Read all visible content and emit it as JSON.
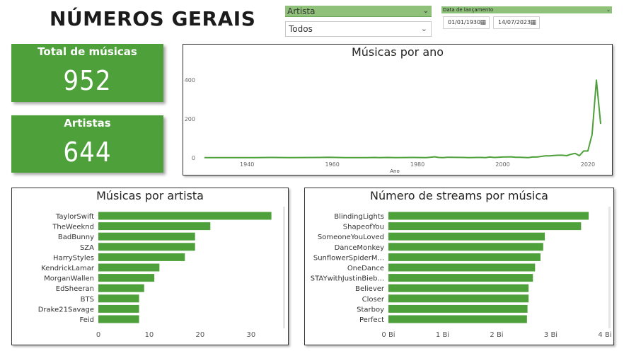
{
  "header": {
    "title": "NÚMEROS GERAIS"
  },
  "filters": {
    "artist_slicer_label": "Artista",
    "artist_dropdown_value": "Todos",
    "date_slicer_label": "Data de lançamento",
    "date_start": "01/01/1930",
    "date_end": "14/07/2023"
  },
  "cards": {
    "total_label": "Total de músicas",
    "total_value": "952",
    "artists_label": "Artistas",
    "artists_value": "644"
  },
  "colors": {
    "accent": "#4ea03a",
    "slicer": "#8fc17a"
  },
  "chart_data": [
    {
      "type": "line",
      "title": "Músicas por ano",
      "xlabel": "Ano",
      "ylabel": "",
      "xlim": [
        1930,
        2024
      ],
      "ylim": [
        0,
        430
      ],
      "x_ticks": [
        "1940",
        "1960",
        "1980",
        "2000",
        "2020"
      ],
      "x_tick_values": [
        1940,
        1960,
        1980,
        2000,
        2020
      ],
      "y_ticks": [
        "0",
        "200",
        "400"
      ],
      "y_tick_values": [
        0,
        200,
        400
      ],
      "x": [
        1930,
        1942,
        1946,
        1950,
        1957,
        1959,
        1963,
        1968,
        1970,
        1971,
        1973,
        1975,
        1979,
        1982,
        1983,
        1984,
        1985,
        1986,
        1987,
        1991,
        1992,
        1994,
        1995,
        1996,
        1997,
        1998,
        1999,
        2000,
        2002,
        2003,
        2004,
        2005,
        2006,
        2007,
        2008,
        2010,
        2011,
        2012,
        2013,
        2014,
        2015,
        2016,
        2017,
        2018,
        2019,
        2020,
        2021,
        2022,
        2023
      ],
      "y": [
        1,
        1,
        2,
        1,
        2,
        3,
        1,
        1,
        2,
        1,
        2,
        1,
        2,
        1,
        3,
        5,
        2,
        1,
        3,
        2,
        1,
        2,
        2,
        1,
        4,
        2,
        3,
        4,
        5,
        3,
        3,
        2,
        1,
        4,
        4,
        10,
        10,
        12,
        13,
        13,
        11,
        18,
        23,
        11,
        35,
        35,
        120,
        400,
        175
      ]
    },
    {
      "type": "bar",
      "orientation": "horizontal",
      "title": "Músicas por artista",
      "categories": [
        "TaylorSwift",
        "TheWeeknd",
        "BadBunny",
        "SZA",
        "HarryStyles",
        "KendrickLamar",
        "MorganWallen",
        "EdSheeran",
        "BTS",
        "Drake21Savage",
        "Feid"
      ],
      "values": [
        34,
        22,
        19,
        19,
        17,
        12,
        11,
        9,
        8,
        8,
        8
      ],
      "x_ticks": [
        "0",
        "10",
        "20",
        "30"
      ],
      "x_tick_values": [
        0,
        10,
        20,
        30
      ],
      "xlim": [
        0,
        36
      ]
    },
    {
      "type": "bar",
      "orientation": "horizontal",
      "title": "Número de streams por música",
      "categories": [
        "BlindingLights",
        "ShapeofYou",
        "SomeoneYouLoved",
        "DanceMonkey",
        "SunflowerSpiderM...",
        "OneDance",
        "STAYwithJustinBieb...",
        "Believer",
        "Closer",
        "Starboy",
        "Perfect"
      ],
      "values": [
        3.7,
        3.56,
        2.89,
        2.86,
        2.81,
        2.71,
        2.67,
        2.59,
        2.59,
        2.57,
        2.56
      ],
      "unit": "Bi",
      "x_ticks": [
        "0 Bi",
        "1 Bi",
        "2 Bi",
        "3 Bi",
        "4 Bi"
      ],
      "x_tick_values": [
        0,
        1,
        2,
        3,
        4
      ],
      "xlim": [
        0,
        4
      ]
    }
  ]
}
